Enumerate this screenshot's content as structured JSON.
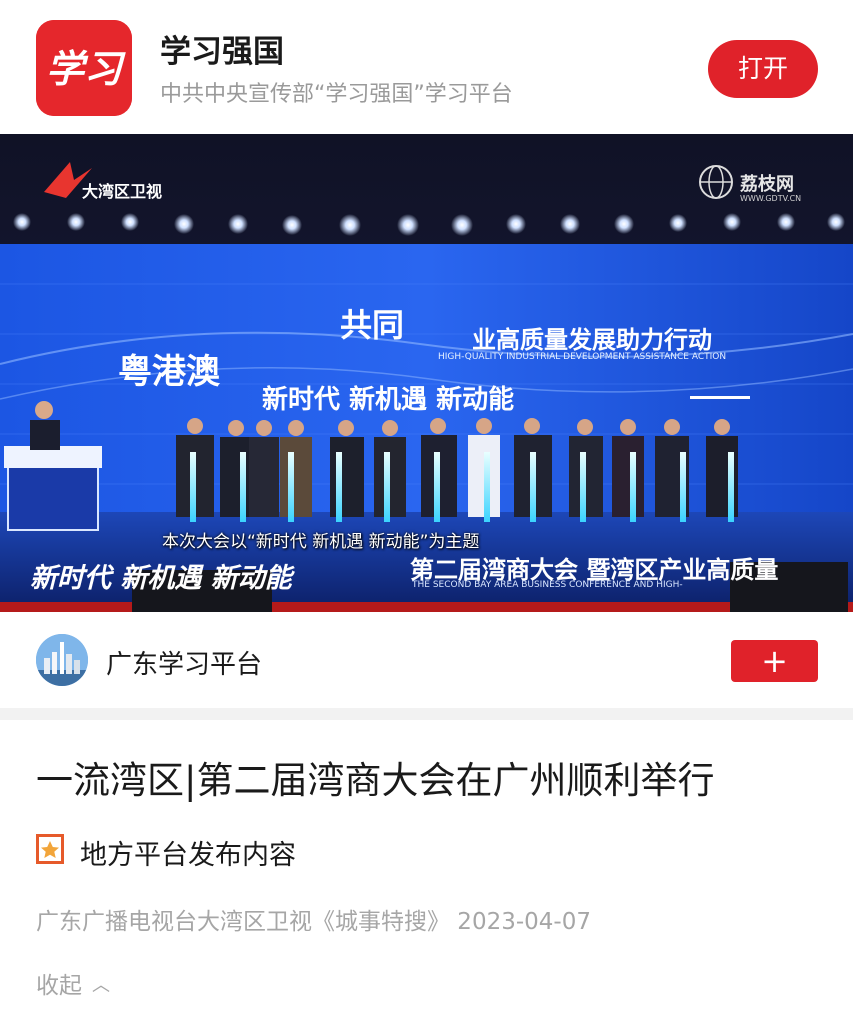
{
  "app_banner": {
    "logo_text": "学习",
    "name": "学习强国",
    "description": "中共中央宣传部“学习强国”学习平台",
    "open_label": "打开"
  },
  "video": {
    "channel_logo": "大湾区卫视",
    "watermark": "荔枝网",
    "watermark_url": "WWW.GDTV.CN",
    "screen_heading_left": "粤港澳",
    "screen_heading_big": "共同",
    "screen_heading": "业高质量发展助力行动",
    "screen_subheading": "HIGH-QUALITY INDUSTRIAL DEVELOPMENT ASSISTANCE ACTION",
    "screen_slogan": "新时代 新机遇 新动能",
    "subtitle": "本次大会以“新时代  新机遇  新动能”为主题",
    "bottom_slogan": "新时代 新机遇 新动能",
    "conference_name": "第二届湾商大会 暨湾区产业高质量",
    "conference_en": "THE SECOND BAY AREA BUSINESS CONFERENCE AND HIGH-"
  },
  "publisher": {
    "name": "广东学习平台",
    "follow_label": "+"
  },
  "article": {
    "title": "一流湾区|第二届湾商大会在广州顺利举行",
    "tag": "地方平台发布内容",
    "source": "广东广播电视台大湾区卫视《城事特搜》 2023-04-07",
    "collapse_label": "收起"
  },
  "colors": {
    "brand_red": "#e0222a",
    "stage_blue": "#1b4fd6",
    "muted_text": "#a6a6a6"
  },
  "icons": {
    "tag": "bookmark-star-icon",
    "collapse": "chevron-up-icon",
    "follow": "plus-icon"
  }
}
